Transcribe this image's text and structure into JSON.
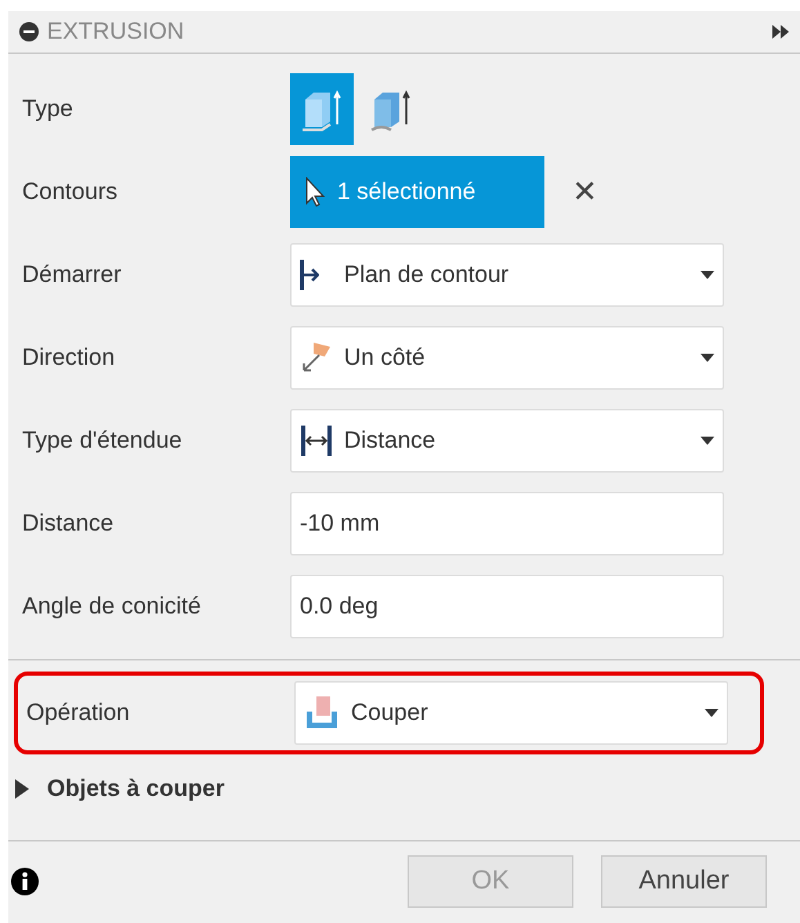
{
  "panel": {
    "title": "EXTRUSION"
  },
  "rows": [
    {
      "kind": "toggle",
      "label": "Type",
      "options": [
        {
          "selected": true
        },
        {
          "selected": false
        }
      ]
    },
    {
      "kind": "selection",
      "label": "Contours",
      "value": "1 sélectionné",
      "clear": "✕"
    },
    {
      "kind": "dropdown",
      "label": "Démarrer",
      "value": "Plan de contour"
    },
    {
      "kind": "dropdown",
      "label": "Direction",
      "value": "Un côté"
    },
    {
      "kind": "dropdown",
      "label": "Type d'étendue",
      "value": "Distance"
    },
    {
      "kind": "input",
      "label": "Distance",
      "value": "-10 mm"
    },
    {
      "kind": "input",
      "label": "Angle de conicité",
      "value": "0.0 deg"
    },
    {
      "kind": "divider"
    },
    {
      "kind": "dropdown",
      "label": "Opération",
      "value": "Couper",
      "highlighted": true
    }
  ],
  "section": {
    "label": "Objets à couper",
    "expanded": false
  },
  "buttons": [
    {
      "label": "OK",
      "disabled": true
    },
    {
      "label": "Annuler",
      "disabled": false
    }
  ]
}
